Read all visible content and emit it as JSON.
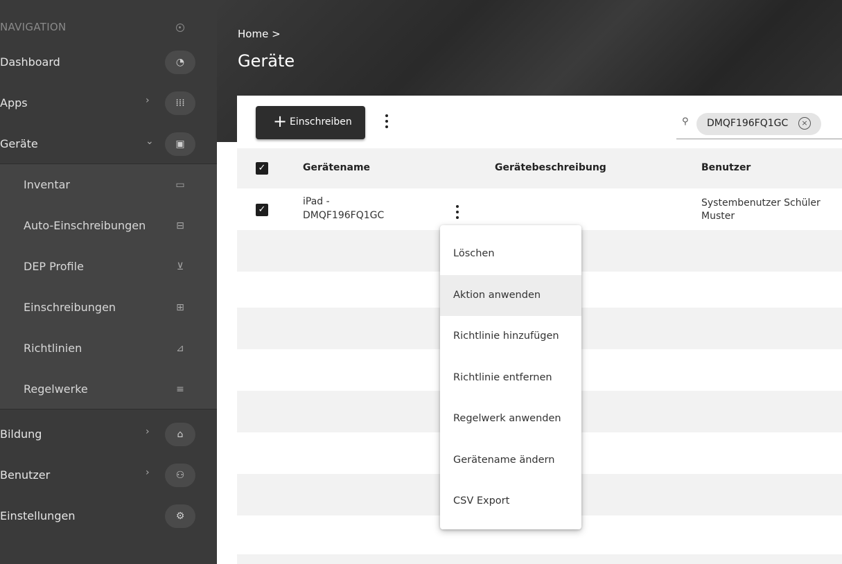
{
  "sidebar": {
    "header": "NAVIGATION",
    "items": [
      {
        "label": "Dashboard",
        "icon": "gauge-icon",
        "glyph": "◔"
      },
      {
        "label": "Apps",
        "icon": "grid-icon",
        "glyph": "⁞⁞⁞",
        "chevron": "›"
      },
      {
        "label": "Geräte",
        "icon": "devices-icon",
        "glyph": "▣",
        "chevron": "⌄"
      },
      {
        "label": "Bildung",
        "icon": "graduation-cap-icon",
        "glyph": "⌂",
        "chevron": "›"
      },
      {
        "label": "Benutzer",
        "icon": "users-settings-icon",
        "glyph": "⚇",
        "chevron": "›"
      },
      {
        "label": "Einstellungen",
        "icon": "gear-icon",
        "glyph": "⚙"
      }
    ],
    "subitems": [
      {
        "label": "Inventar",
        "icon": "inventory-icon",
        "glyph": "▭"
      },
      {
        "label": "Auto-Einschreibungen",
        "icon": "auto-enroll-icon",
        "glyph": "⊟"
      },
      {
        "label": "DEP Profile",
        "icon": "dep-profile-icon",
        "glyph": "⊻"
      },
      {
        "label": "Einschreibungen",
        "icon": "enrollment-icon",
        "glyph": "⊞"
      },
      {
        "label": "Richtlinien",
        "icon": "policy-icon",
        "glyph": "⊿"
      },
      {
        "label": "Regelwerke",
        "icon": "ruleset-icon",
        "glyph": "≡"
      }
    ]
  },
  "header": {
    "breadcrumb": "Home >",
    "title": "Geräte"
  },
  "toolbar": {
    "enroll_plus": "+",
    "enroll_label": "Einschreiben",
    "search_icon": "⚲",
    "search_chip": "DMQF196FQ1GC",
    "chip_clear": "×"
  },
  "table": {
    "columns": [
      "Gerätename",
      "Gerätebeschreibung",
      "Benutzer"
    ],
    "rows": [
      {
        "checked": true,
        "name_line1": "iPad -",
        "name_line2": "DMQF196FQ1GC",
        "description": "",
        "user_line1": "Systembenutzer Schüler",
        "user_line2": "Muster"
      }
    ],
    "check_glyph": "✓"
  },
  "context_menu": {
    "items": [
      "Löschen",
      "Aktion anwenden",
      "Richtlinie hinzufügen",
      "Richtlinie entfernen",
      "Regelwerk anwenden",
      "Gerätename ändern",
      "CSV Export"
    ],
    "highlighted": "Aktion anwenden"
  }
}
